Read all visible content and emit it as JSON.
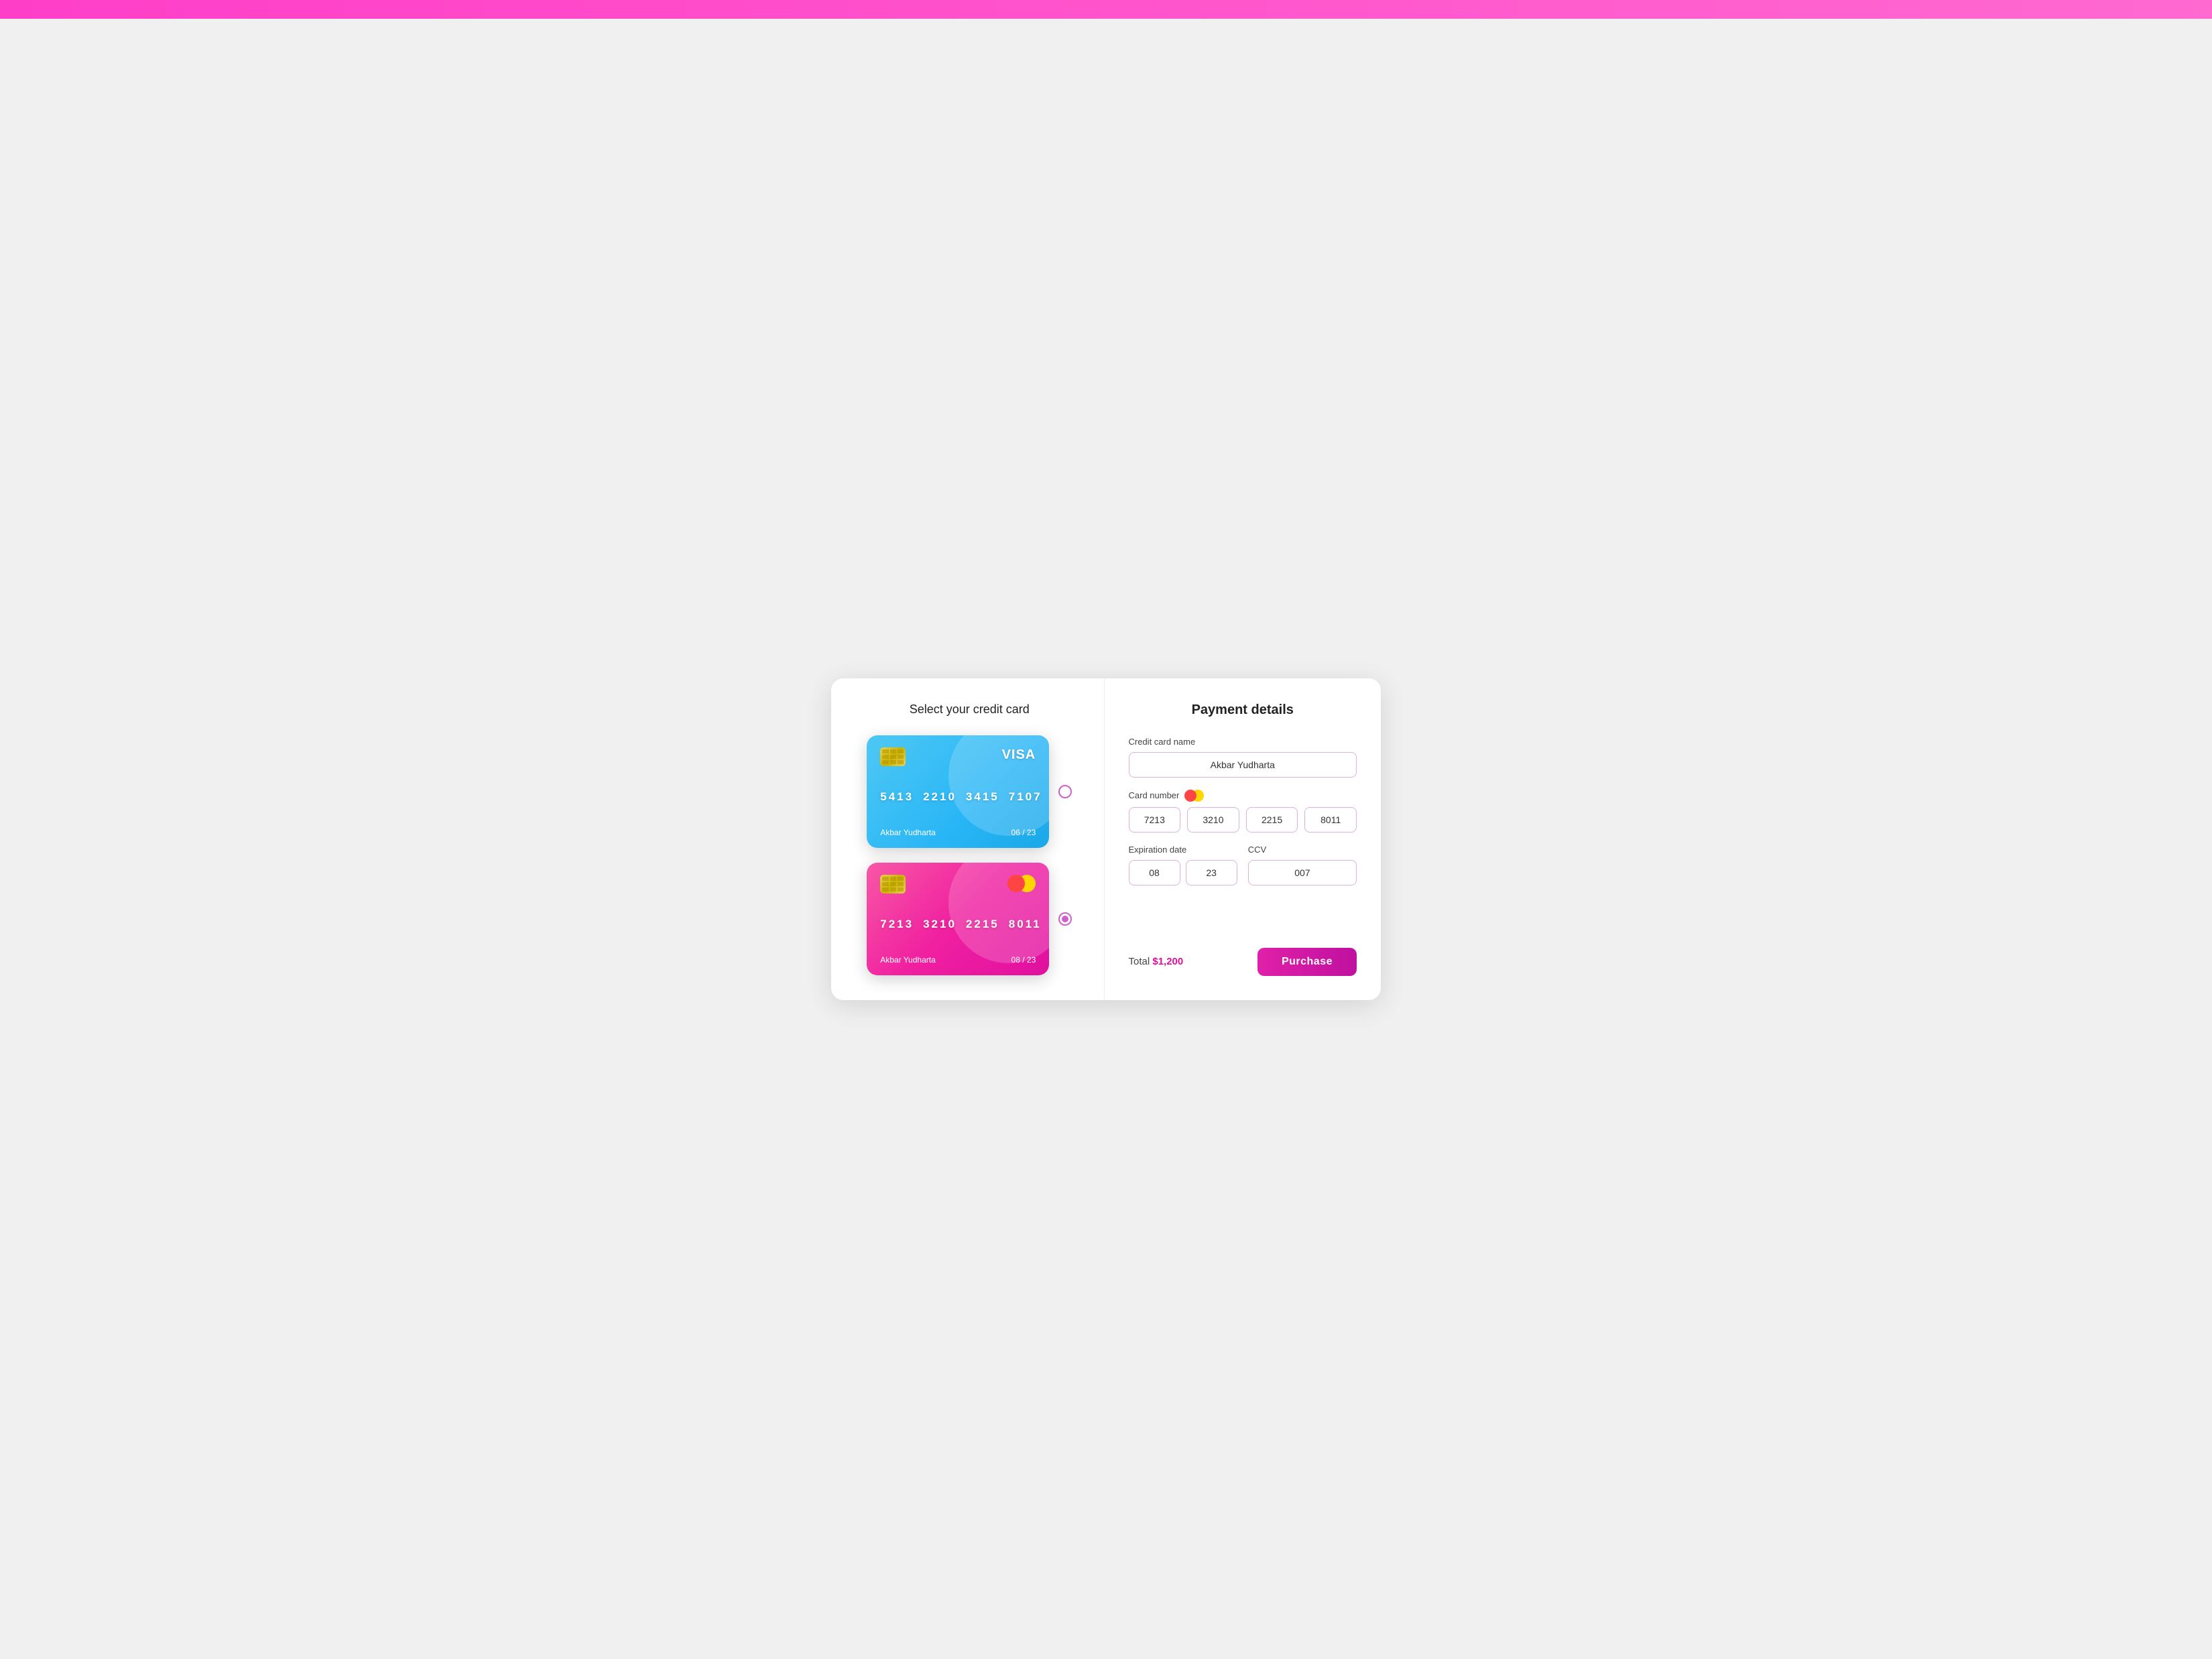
{
  "topbar": {
    "color": "#ff3ec8"
  },
  "left": {
    "title": "Select your credit card",
    "cards": [
      {
        "id": "visa-card",
        "type": "blue",
        "brand": "VISA",
        "brand_type": "text",
        "number": [
          "5413",
          "2210",
          "3415",
          "7107"
        ],
        "holder": "Akbar Yudharta",
        "expiry": "06 / 23",
        "selected": false
      },
      {
        "id": "mc-card",
        "type": "pink",
        "brand": "mastercard",
        "brand_type": "circles",
        "number": [
          "7213",
          "3210",
          "2215",
          "8011"
        ],
        "holder": "Akbar Yudharta",
        "expiry": "08 / 23",
        "selected": true
      }
    ]
  },
  "right": {
    "title": "Payment details",
    "fields": {
      "cc_name_label": "Credit card name",
      "cc_name_value": "Akbar Yudharta",
      "card_number_label": "Card number",
      "card_number_parts": [
        "7213",
        "3210",
        "2215",
        "8011"
      ],
      "expiration_label": "Expiration date",
      "exp_month": "08",
      "exp_year": "23",
      "ccv_label": "CCV",
      "ccv_value": "007"
    },
    "total_label": "Total",
    "total_amount": "$1,200",
    "purchase_label": "Purchase"
  }
}
